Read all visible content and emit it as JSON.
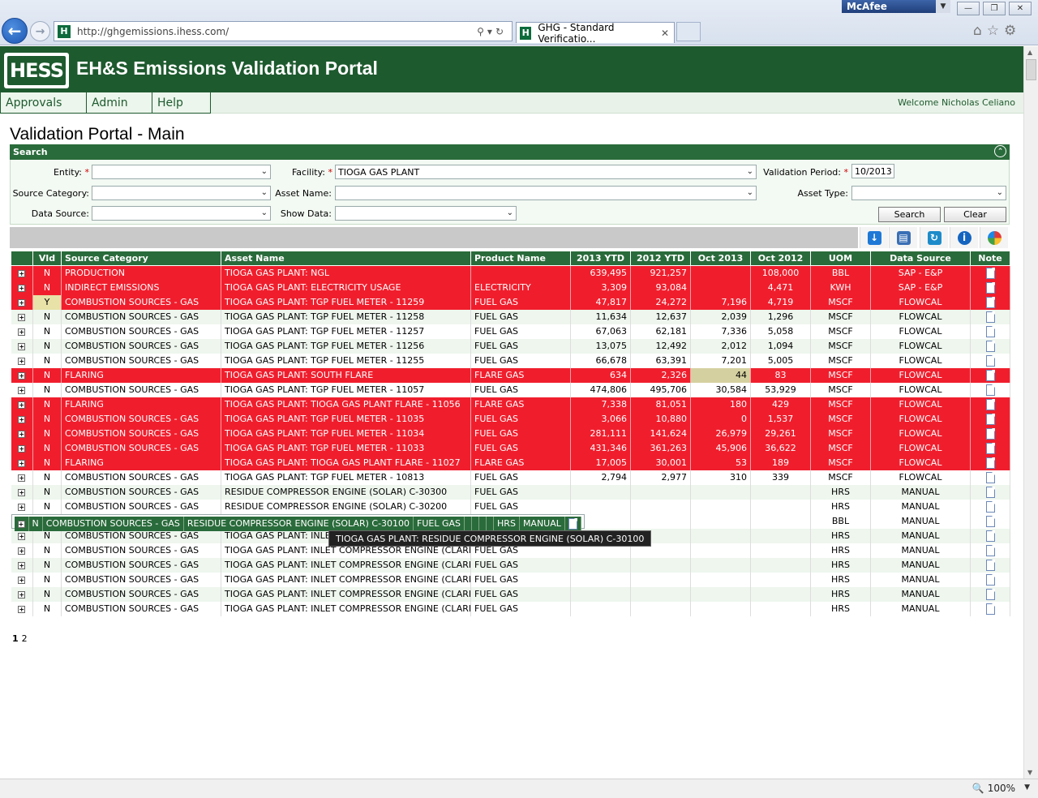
{
  "browser": {
    "url": "http://ghgemissions.ihess.com/",
    "tab_title": "GHG - Standard Verificatio...",
    "addon": "McAfee",
    "zoom": "100%"
  },
  "app": {
    "logo_text": "HESS",
    "title": "EH&S Emissions Validation Portal",
    "menu": [
      "Approvals",
      "Admin",
      "Help"
    ],
    "welcome": "Welcome Nicholas Celiano",
    "page_title": "Validation Portal - Main"
  },
  "search": {
    "header": "Search",
    "labels": {
      "entity": "Entity:",
      "facility": "Facility:",
      "validation_period": "Validation Period:",
      "source_category": "Source Category:",
      "asset_name": "Asset Name:",
      "asset_type": "Asset Type:",
      "data_source": "Data Source:",
      "show_data": "Show Data:"
    },
    "values": {
      "entity": "",
      "facility": "TIOGA GAS PLANT",
      "validation_period": "10/2013",
      "source_category": "",
      "asset_name": "",
      "asset_type": "",
      "data_source": "",
      "show_data": ""
    },
    "buttons": {
      "search": "Search",
      "clear": "Clear"
    }
  },
  "grid": {
    "columns": [
      "",
      "Vld",
      "Source Category",
      "Asset Name",
      "Product Name",
      "2013 YTD",
      "2012 YTD",
      "Oct 2013",
      "Oct 2012",
      "UOM",
      "Data Source",
      "Note"
    ],
    "rows": [
      {
        "style": "red",
        "vld": "N",
        "cat": "PRODUCTION",
        "asset": "TIOGA GAS PLANT: NGL",
        "product": "",
        "ytd13": "639,495",
        "ytd12": "921,257",
        "oct13": "",
        "oct12": "108,000",
        "uom": "BBL",
        "src": "SAP - E&P"
      },
      {
        "style": "red",
        "vld": "N",
        "cat": "INDIRECT EMISSIONS",
        "asset": "TIOGA GAS PLANT: ELECTRICITY USAGE",
        "product": "ELECTRICITY",
        "ytd13": "3,309",
        "ytd12": "93,084",
        "oct13": "",
        "oct12": "4,471",
        "uom": "KWH",
        "src": "SAP - E&P"
      },
      {
        "style": "red",
        "vld": "Y",
        "cat": "COMBUSTION SOURCES - GAS",
        "asset": "TIOGA GAS PLANT: TGP FUEL METER - 11259",
        "product": "FUEL GAS",
        "ytd13": "47,817",
        "ytd12": "24,272",
        "oct13": "7,196",
        "oct12": "4,719",
        "uom": "MSCF",
        "src": "FLOWCAL"
      },
      {
        "style": "alt",
        "vld": "N",
        "cat": "COMBUSTION SOURCES - GAS",
        "asset": "TIOGA GAS PLANT: TGP FUEL METER - 11258",
        "product": "FUEL GAS",
        "ytd13": "11,634",
        "ytd12": "12,637",
        "oct13": "2,039",
        "oct12": "1,296",
        "uom": "MSCF",
        "src": "FLOWCAL"
      },
      {
        "style": "white",
        "vld": "N",
        "cat": "COMBUSTION SOURCES - GAS",
        "asset": "TIOGA GAS PLANT: TGP FUEL METER - 11257",
        "product": "FUEL GAS",
        "ytd13": "67,063",
        "ytd12": "62,181",
        "oct13": "7,336",
        "oct12": "5,058",
        "uom": "MSCF",
        "src": "FLOWCAL"
      },
      {
        "style": "alt",
        "vld": "N",
        "cat": "COMBUSTION SOURCES - GAS",
        "asset": "TIOGA GAS PLANT: TGP FUEL METER - 11256",
        "product": "FUEL GAS",
        "ytd13": "13,075",
        "ytd12": "12,492",
        "oct13": "2,012",
        "oct12": "1,094",
        "uom": "MSCF",
        "src": "FLOWCAL"
      },
      {
        "style": "white",
        "vld": "N",
        "cat": "COMBUSTION SOURCES - GAS",
        "asset": "TIOGA GAS PLANT: TGP FUEL METER - 11255",
        "product": "FUEL GAS",
        "ytd13": "66,678",
        "ytd12": "63,391",
        "oct13": "7,201",
        "oct12": "5,005",
        "uom": "MSCF",
        "src": "FLOWCAL"
      },
      {
        "style": "red",
        "vld": "N",
        "cat": "FLARING",
        "asset": "TIOGA GAS PLANT: SOUTH FLARE",
        "product": "FLARE GAS",
        "ytd13": "634",
        "ytd12": "2,326",
        "oct13": "44",
        "oct12": "83",
        "uom": "MSCF",
        "src": "FLOWCAL",
        "khaki": true
      },
      {
        "style": "white",
        "vld": "N",
        "cat": "COMBUSTION SOURCES - GAS",
        "asset": "TIOGA GAS PLANT: TGP FUEL METER - 11057",
        "product": "FUEL GAS",
        "ytd13": "474,806",
        "ytd12": "495,706",
        "oct13": "30,584",
        "oct12": "53,929",
        "uom": "MSCF",
        "src": "FLOWCAL"
      },
      {
        "style": "red",
        "vld": "N",
        "cat": "FLARING",
        "asset": "TIOGA GAS PLANT: TIOGA GAS PLANT FLARE - 11056",
        "product": "FLARE GAS",
        "ytd13": "7,338",
        "ytd12": "81,051",
        "oct13": "180",
        "oct12": "429",
        "uom": "MSCF",
        "src": "FLOWCAL"
      },
      {
        "style": "red",
        "vld": "N",
        "cat": "COMBUSTION SOURCES - GAS",
        "asset": "TIOGA GAS PLANT: TGP FUEL METER - 11035",
        "product": "FUEL GAS",
        "ytd13": "3,066",
        "ytd12": "10,880",
        "oct13": "0",
        "oct12": "1,537",
        "uom": "MSCF",
        "src": "FLOWCAL"
      },
      {
        "style": "red",
        "vld": "N",
        "cat": "COMBUSTION SOURCES - GAS",
        "asset": "TIOGA GAS PLANT: TGP FUEL METER - 11034",
        "product": "FUEL GAS",
        "ytd13": "281,111",
        "ytd12": "141,624",
        "oct13": "26,979",
        "oct12": "29,261",
        "uom": "MSCF",
        "src": "FLOWCAL"
      },
      {
        "style": "red",
        "vld": "N",
        "cat": "COMBUSTION SOURCES - GAS",
        "asset": "TIOGA GAS PLANT: TGP FUEL METER - 11033",
        "product": "FUEL GAS",
        "ytd13": "431,346",
        "ytd12": "361,263",
        "oct13": "45,906",
        "oct12": "36,622",
        "uom": "MSCF",
        "src": "FLOWCAL"
      },
      {
        "style": "red",
        "vld": "N",
        "cat": "FLARING",
        "asset": "TIOGA GAS PLANT: TIOGA GAS PLANT FLARE - 11027",
        "product": "FLARE GAS",
        "ytd13": "17,005",
        "ytd12": "30,001",
        "oct13": "53",
        "oct12": "189",
        "uom": "MSCF",
        "src": "FLOWCAL"
      },
      {
        "style": "white",
        "vld": "N",
        "cat": "COMBUSTION SOURCES - GAS",
        "asset": "TIOGA GAS PLANT: TGP FUEL METER - 10813",
        "product": "FUEL GAS",
        "ytd13": "2,794",
        "ytd12": "2,977",
        "oct13": "310",
        "oct12": "339",
        "uom": "MSCF",
        "src": "FLOWCAL"
      },
      {
        "style": "alt",
        "vld": "N",
        "cat": "COMBUSTION SOURCES - GAS",
        "asset": "RESIDUE COMPRESSOR ENGINE (SOLAR) C-30300",
        "product": "FUEL GAS",
        "ytd13": "",
        "ytd12": "",
        "oct13": "",
        "oct12": "",
        "uom": "HRS",
        "src": "MANUAL"
      },
      {
        "style": "white",
        "vld": "N",
        "cat": "COMBUSTION SOURCES - GAS",
        "asset": "RESIDUE COMPRESSOR ENGINE (SOLAR) C-30200",
        "product": "FUEL GAS",
        "ytd13": "",
        "ytd12": "",
        "oct13": "",
        "oct12": "",
        "uom": "HRS",
        "src": "MANUAL"
      },
      {
        "style": "sel",
        "vld": "N",
        "cat": "COMBUSTION SOURCES - GAS",
        "asset": "RESIDUE COMPRESSOR ENGINE (SOLAR) C-30100",
        "product": "FUEL GAS",
        "ytd13": "",
        "ytd12": "",
        "oct13": "",
        "oct12": "",
        "uom": "HRS",
        "src": "MANUAL"
      },
      {
        "style": "white",
        "vld": "N",
        "cat": "PRODUCTION",
        "asset": "TIOGA GAS PLANT: PRO",
        "product": "",
        "ytd13": "",
        "ytd12": "",
        "oct13": "",
        "oct12": "",
        "uom": "BBL",
        "src": "MANUAL"
      },
      {
        "style": "alt",
        "vld": "N",
        "cat": "COMBUSTION SOURCES - GAS",
        "asset": "TIOGA GAS PLANT: INLET COMPRESSOR ENGINE (CLARK",
        "product": "FUEL GAS",
        "ytd13": "",
        "ytd12": "",
        "oct13": "",
        "oct12": "",
        "uom": "HRS",
        "src": "MANUAL"
      },
      {
        "style": "white",
        "vld": "N",
        "cat": "COMBUSTION SOURCES - GAS",
        "asset": "TIOGA GAS PLANT: INLET COMPRESSOR ENGINE (CLARK",
        "product": "FUEL GAS",
        "ytd13": "",
        "ytd12": "",
        "oct13": "",
        "oct12": "",
        "uom": "HRS",
        "src": "MANUAL"
      },
      {
        "style": "alt",
        "vld": "N",
        "cat": "COMBUSTION SOURCES - GAS",
        "asset": "TIOGA GAS PLANT: INLET COMPRESSOR ENGINE (CLARK",
        "product": "FUEL GAS",
        "ytd13": "",
        "ytd12": "",
        "oct13": "",
        "oct12": "",
        "uom": "HRS",
        "src": "MANUAL"
      },
      {
        "style": "white",
        "vld": "N",
        "cat": "COMBUSTION SOURCES - GAS",
        "asset": "TIOGA GAS PLANT: INLET COMPRESSOR ENGINE (CLARK",
        "product": "FUEL GAS",
        "ytd13": "",
        "ytd12": "",
        "oct13": "",
        "oct12": "",
        "uom": "HRS",
        "src": "MANUAL"
      },
      {
        "style": "alt",
        "vld": "N",
        "cat": "COMBUSTION SOURCES - GAS",
        "asset": "TIOGA GAS PLANT: INLET COMPRESSOR ENGINE (CLARK",
        "product": "FUEL GAS",
        "ytd13": "",
        "ytd12": "",
        "oct13": "",
        "oct12": "",
        "uom": "HRS",
        "src": "MANUAL"
      },
      {
        "style": "white",
        "vld": "N",
        "cat": "COMBUSTION SOURCES - GAS",
        "asset": "TIOGA GAS PLANT: INLET COMPRESSOR ENGINE (CLARK",
        "product": "FUEL GAS",
        "ytd13": "",
        "ytd12": "",
        "oct13": "",
        "oct12": "",
        "uom": "HRS",
        "src": "MANUAL"
      }
    ],
    "pages": [
      "1",
      "2"
    ],
    "current_page": "1"
  },
  "tooltip": "TIOGA GAS PLANT: RESIDUE COMPRESSOR ENGINE (SOLAR) C-30100",
  "icons": [
    "back-icon",
    "forward-icon",
    "search-icon",
    "refresh-icon",
    "home-icon",
    "favorites-icon",
    "tools-icon",
    "download-icon",
    "save-icon",
    "refresh-data-icon",
    "info-icon",
    "chart-icon",
    "note-icon",
    "expand-icon",
    "collapse-icon"
  ]
}
